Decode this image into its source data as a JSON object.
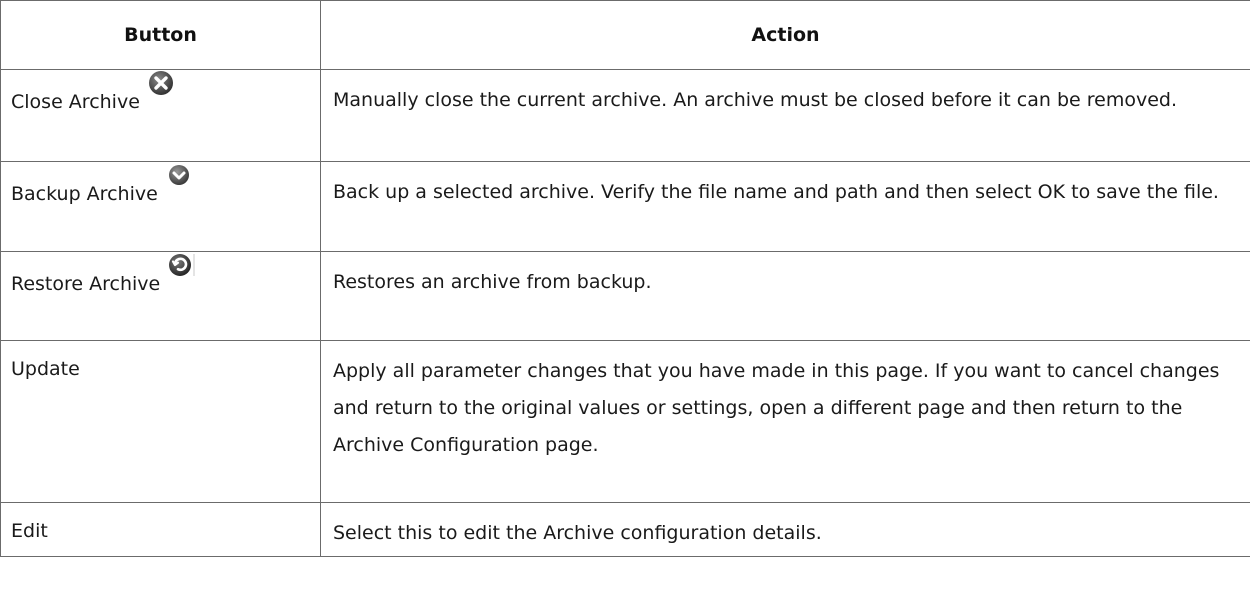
{
  "table": {
    "headers": [
      "Button",
      "Action"
    ],
    "rows": [
      {
        "button": "Close Archive",
        "icon": "close-circle-icon",
        "action": "Manually close the current archive. An archive must be closed before it can be removed."
      },
      {
        "button": "Backup Archive",
        "icon": "backup-down-arrow-icon",
        "action": "Back up a selected archive. Verify the file name and path and then select OK to save the file."
      },
      {
        "button": "Restore Archive",
        "icon": "restore-arrow-icon",
        "action": "Restores an archive from backup."
      },
      {
        "button": "Update",
        "icon": "",
        "action": "Apply all parameter changes that you have made in this page. If you want to cancel changes and return to the original values or settings, open a different page and then return to the Archive Configuration page."
      },
      {
        "button": "Edit",
        "icon": "",
        "action": "Select this to edit the Archive configuration details."
      }
    ]
  }
}
